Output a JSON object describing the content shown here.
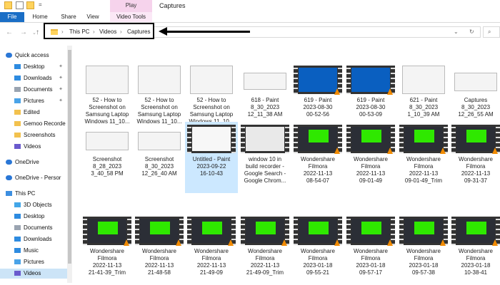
{
  "window": {
    "title": "Captures",
    "context_tab": "Play"
  },
  "ribbon": {
    "tabs": [
      "File",
      "Home",
      "Share",
      "View",
      "Video Tools"
    ]
  },
  "address": {
    "breadcrumb": [
      "This PC",
      "Videos",
      "Captures"
    ]
  },
  "sidebar": {
    "items": [
      {
        "label": "Quick access",
        "icon": "star-icon",
        "pinned": false
      },
      {
        "label": "Desktop",
        "icon": "desktop-folder-icon",
        "pinned": true
      },
      {
        "label": "Downloads",
        "icon": "download-icon",
        "pinned": true
      },
      {
        "label": "Documents",
        "icon": "document-folder-icon",
        "pinned": true
      },
      {
        "label": "Pictures",
        "icon": "pictures-folder-icon",
        "pinned": true
      },
      {
        "label": "Edited",
        "icon": "folder-icon",
        "pinned": false
      },
      {
        "label": "Gemoo Recorde",
        "icon": "folder-icon",
        "pinned": false
      },
      {
        "label": "Screenshots",
        "icon": "folder-icon",
        "pinned": false
      },
      {
        "label": "Videos",
        "icon": "videos-folder-icon",
        "pinned": false
      },
      {
        "label": "OneDrive",
        "icon": "cloud-icon",
        "pinned": false
      },
      {
        "label": "OneDrive - Persor",
        "icon": "cloud-icon",
        "pinned": false
      },
      {
        "label": "This PC",
        "icon": "computer-icon",
        "pinned": false
      },
      {
        "label": "3D Objects",
        "icon": "cube-icon",
        "pinned": false
      },
      {
        "label": "Desktop",
        "icon": "desktop-folder-icon",
        "pinned": false
      },
      {
        "label": "Documents",
        "icon": "document-folder-icon",
        "pinned": false
      },
      {
        "label": "Downloads",
        "icon": "download-icon",
        "pinned": false
      },
      {
        "label": "Music",
        "icon": "music-icon",
        "pinned": false
      },
      {
        "label": "Pictures",
        "icon": "pictures-folder-icon",
        "pinned": false
      },
      {
        "label": "Videos",
        "icon": "videos-folder-icon",
        "pinned": false,
        "selected": true
      }
    ]
  },
  "files": [
    {
      "lines": [
        "52 - How to",
        "Screenshot on",
        "Samsung Laptop",
        "Windows 11_10..."
      ],
      "type": "image"
    },
    {
      "lines": [
        "52 - How to",
        "Screenshot on",
        "Samsung Laptop",
        "Windows 11_10..."
      ],
      "type": "image"
    },
    {
      "lines": [
        "52 - How to",
        "Screenshot on",
        "Samsung Laptop",
        "Windows 11_10..."
      ],
      "type": "image"
    },
    {
      "lines": [
        "618 - Paint",
        "8_30_2023",
        "12_11_38 AM"
      ],
      "type": "image"
    },
    {
      "lines": [
        "619 - Paint",
        "2023-08-30",
        "00-52-56"
      ],
      "type": "video"
    },
    {
      "lines": [
        "619 - Paint",
        "2023-08-30",
        "00-53-09"
      ],
      "type": "video"
    },
    {
      "lines": [
        "621 - Paint",
        "8_30_2023",
        "1_10_39 AM"
      ],
      "type": "image"
    },
    {
      "lines": [
        "Captures",
        "8_30_2023",
        "12_26_55 AM"
      ],
      "type": "image"
    },
    {
      "lines": [
        "Screenshot",
        "8_28_2023",
        "3_40_58 PM"
      ],
      "type": "image"
    },
    {
      "lines": [
        "Screenshot",
        "8_30_2023",
        "12_26_40 AM"
      ],
      "type": "image"
    },
    {
      "lines": [
        "Untitled - Paint",
        "2023-09-22",
        "16-10-43"
      ],
      "type": "video",
      "selected": true
    },
    {
      "lines": [
        "window 10 in",
        "build recorder -",
        "Google Search -",
        "Google Chrom..."
      ],
      "type": "video"
    },
    {
      "lines": [
        "Wondershare",
        "Filmora",
        "2022-11-13",
        "08-54-07"
      ],
      "type": "video"
    },
    {
      "lines": [
        "Wondershare",
        "Filmora",
        "2022-11-13",
        "09-01-49"
      ],
      "type": "video"
    },
    {
      "lines": [
        "Wondershare",
        "Filmora",
        "2022-11-13",
        "09-01-49_Trim"
      ],
      "type": "video"
    },
    {
      "lines": [
        "Wondershare",
        "Filmora",
        "2022-11-13",
        "09-31-37"
      ],
      "type": "video"
    },
    {
      "lines": [
        "Wondershare",
        "Filmora",
        "2022-11-13",
        "21-41-39_Trim"
      ],
      "type": "video"
    },
    {
      "lines": [
        "Wondershare",
        "Filmora",
        "2022-11-13",
        "21-48-58"
      ],
      "type": "video"
    },
    {
      "lines": [
        "Wondershare",
        "Filmora",
        "2022-11-13",
        "21-49-09"
      ],
      "type": "video"
    },
    {
      "lines": [
        "Wondershare",
        "Filmora",
        "2022-11-13",
        "21-49-09_Trim"
      ],
      "type": "video"
    },
    {
      "lines": [
        "Wondershare",
        "Filmora",
        "2023-01-18",
        "09-55-21"
      ],
      "type": "video"
    },
    {
      "lines": [
        "Wondershare",
        "Filmora",
        "2023-01-18",
        "09-57-17"
      ],
      "type": "video"
    },
    {
      "lines": [
        "Wondershare",
        "Filmora",
        "2023-01-18",
        "09-57-38"
      ],
      "type": "video"
    },
    {
      "lines": [
        "Wondershare",
        "Filmora",
        "2023-01-18",
        "10-38-41"
      ],
      "type": "video"
    }
  ],
  "colors": {
    "accent": "#1a6ec6",
    "selection": "#cce8ff",
    "play_tab": "#f6d3ec",
    "filmora_green": "#2fe800"
  }
}
